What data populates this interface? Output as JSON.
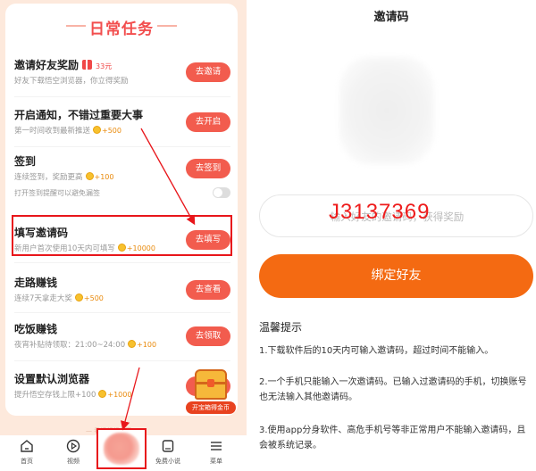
{
  "left": {
    "title": "日常任务",
    "tasks": [
      {
        "name": "邀请好友奖励",
        "desc": "好友下载悟空浏览器，你立得奖励",
        "reward": "33元",
        "button": "去邀请"
      },
      {
        "name": "开启通知，不错过重要大事",
        "desc": "第一时间收到最新推送",
        "reward": "+500",
        "button": "去开启"
      },
      {
        "name": "签到",
        "desc": "连续签到，奖励更高",
        "reward": "+100",
        "button": "去签到"
      },
      {
        "name": "填写邀请码",
        "desc": "新用户首次使用10天内可填写",
        "reward": "+10000",
        "button": "去填写"
      },
      {
        "name": "走路赚钱",
        "desc": "连续7天拿走大奖",
        "reward": "+500",
        "button": "去查看"
      },
      {
        "name": "吃饭赚钱",
        "desc": "夜宵补贴待领取：21:00~24:00",
        "reward": "+100",
        "button": "去领取"
      },
      {
        "name": "设置默认浏览器",
        "desc": "提升悟空存钱上限+100",
        "reward": "+1000",
        "button": "去设置"
      }
    ],
    "reminder": "打开签到提醒可以避免漏签",
    "treasure_label": "开宝箱得金币",
    "faint_text": "— 看视频领金币 —",
    "nav": [
      {
        "label": "首页",
        "icon": "home-icon"
      },
      {
        "label": "视频",
        "icon": "play-icon"
      },
      {
        "label": "免费小说",
        "icon": "book-icon"
      },
      {
        "label": "菜单",
        "icon": "menu-icon"
      }
    ],
    "colors": {
      "accent": "#f25c4e",
      "highlight": "#e8161b",
      "coin": "#f7c12e"
    }
  },
  "right": {
    "title": "邀请码",
    "input_placeholder": "输入好友的邀请码，获得奖励",
    "code_value": "J3137369",
    "bind_button": "绑定好友",
    "tips_title": "温馨提示",
    "tips": [
      "1.下载软件后的10天内可输入邀请码，超过时间不能输入。",
      "2.一个手机只能输入一次邀请码。已输入过邀请码的手机，切换账号也无法输入其他邀请码。",
      "3.使用app分身软件、高危手机号等非正常用户不能输入邀请码，且会被系统记录。"
    ],
    "colors": {
      "button": "#f46a12",
      "code": "#ee1c1c"
    }
  }
}
